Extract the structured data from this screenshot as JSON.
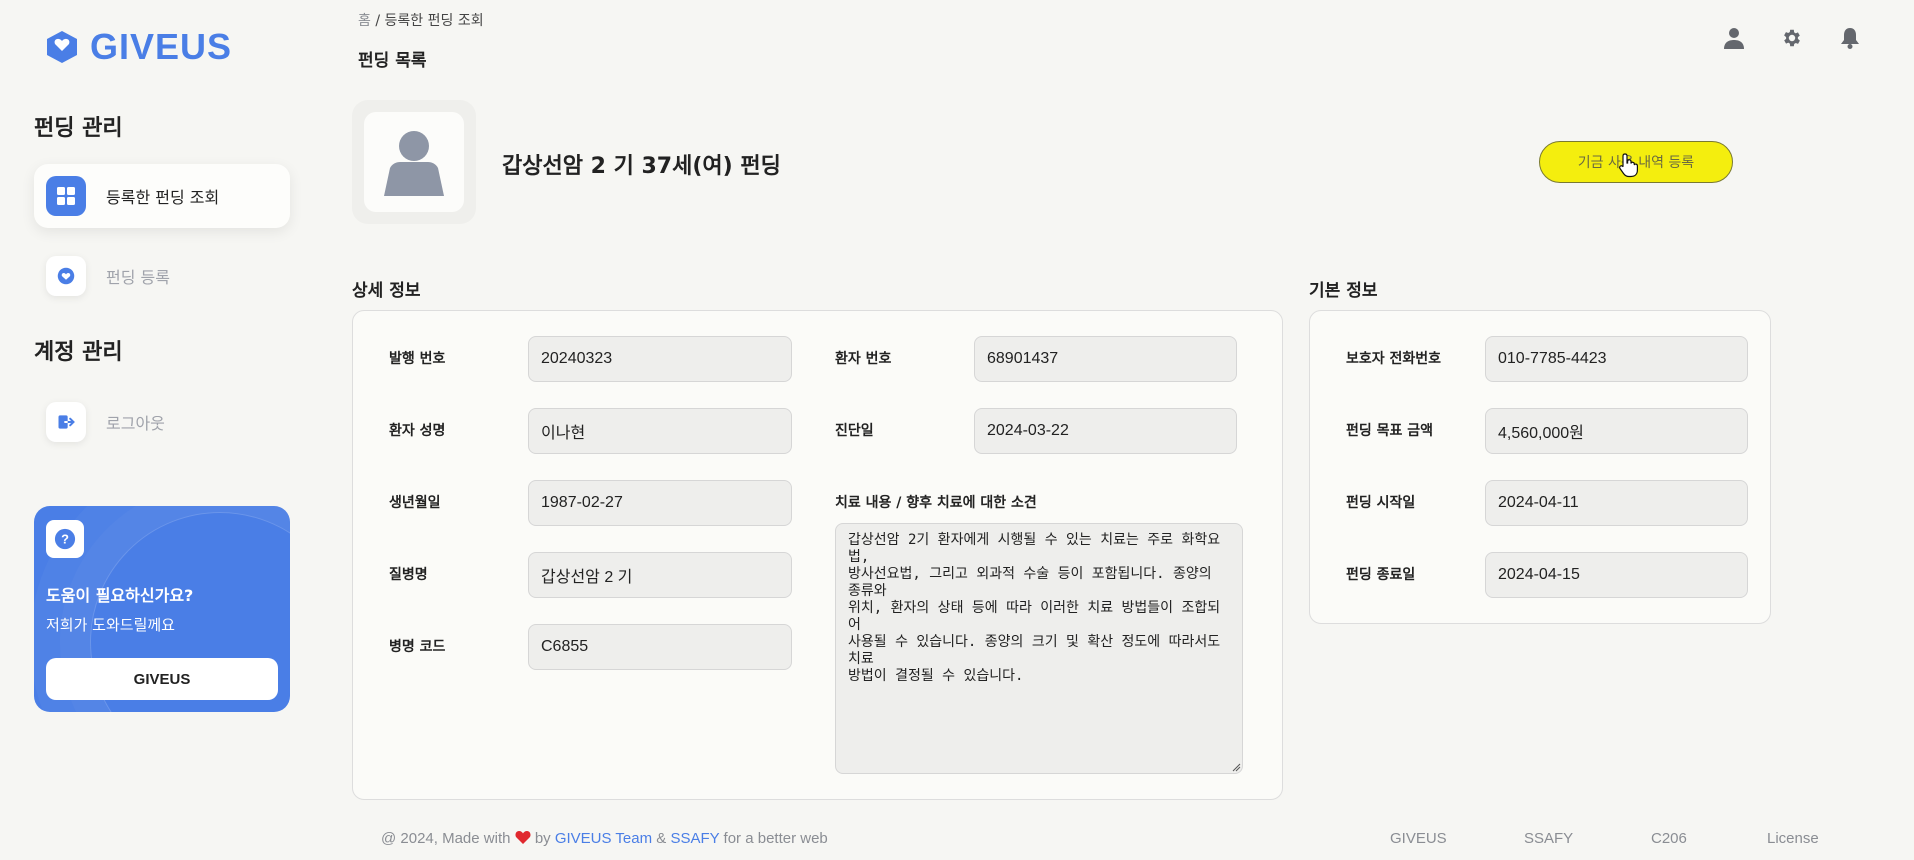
{
  "brand": {
    "name": "GIVEUS",
    "color": "#4a7ee6"
  },
  "sidebar": {
    "section1": "펀딩 관리",
    "items": [
      {
        "label": "등록한 펀딩 조회",
        "icon": "grid-icon",
        "active": true
      },
      {
        "label": "펀딩 등록",
        "icon": "heart-icon",
        "active": false
      }
    ],
    "section2": "계정 관리",
    "account_items": [
      {
        "label": "로그아웃",
        "icon": "logout-icon"
      }
    ],
    "help": {
      "title": "도움이 필요하신가요?",
      "subtitle": "저희가 도와드릴께요",
      "button": "GIVEUS"
    }
  },
  "header": {
    "breadcrumb_home": "홈",
    "breadcrumb_sep": "/",
    "breadcrumb_current": "등록한 펀딩 조회",
    "page_title": "펀딩 목록"
  },
  "hero": {
    "title": "갑상선암 2 기 37세(여) 펀딩",
    "cta_label": "기금 사용 내역 등록",
    "cta_color": "#f4ee0e"
  },
  "detail": {
    "title": "상세 정보",
    "fields": {
      "issue_no_label": "발행 번호",
      "issue_no": "20240323",
      "patient_no_label": "환자 번호",
      "patient_no": "68901437",
      "patient_name_label": "환자 성명",
      "patient_name": "이나현",
      "diagnosis_date_label": "진단일",
      "diagnosis_date": "2024-03-22",
      "birth_label": "생년월일",
      "birth": "1987-02-27",
      "disease_label": "질병명",
      "disease": "갑상선암 2 기",
      "code_label": "병명 코드",
      "code": "C6855"
    },
    "opinion_label": "치료 내용 / 향후 치료에 대한 소견",
    "opinion": "갑상선암 2기 환자에게 시행될 수 있는 치료는 주로 화학요법,\n방사선요법, 그리고 외과적 수술 등이 포함됩니다. 종양의 종류와\n위치, 환자의 상태 등에 따라 이러한 치료 방법들이 조합되어\n사용될 수 있습니다. 종양의 크기 및 확산 정도에 따라서도 치료\n방법이 결정될 수 있습니다."
  },
  "basic": {
    "title": "기본 정보",
    "guardian_phone_label": "보호자 전화번호",
    "guardian_phone": "010-7785-4423",
    "goal_label": "펀딩 목표 금액",
    "goal": "4,560,000원",
    "start_label": "펀딩 시작일",
    "start": "2024-04-11",
    "end_label": "펀딩 종료일",
    "end": "2024-04-15"
  },
  "footer": {
    "prefix": "@ 2024, Made with",
    "by": "by",
    "team": "GIVEUS Team",
    "amp": "&",
    "org": "SSAFY",
    "suffix": "for a better web",
    "links": [
      "GIVEUS",
      "SSAFY",
      "C206",
      "License"
    ]
  }
}
